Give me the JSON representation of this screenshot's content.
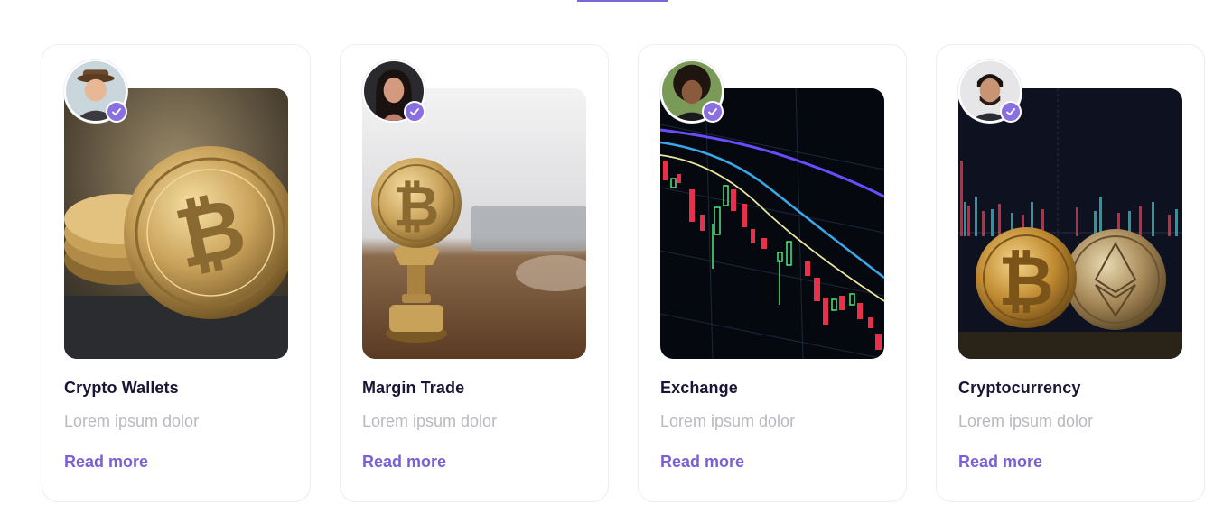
{
  "theme": {
    "accent": "#7a5fd6",
    "title_color": "#1b1535",
    "muted_text": "#b8b8c0",
    "card_border": "#ececf2"
  },
  "cards": [
    {
      "title": "Crypto Wallets",
      "subtitle": "Lorem ipsum dolor",
      "link": "Read more",
      "image": "bitcoin-coins-stack",
      "avatar": "man-with-hat",
      "badge_icon": "check-icon"
    },
    {
      "title": "Margin Trade",
      "subtitle": "Lorem ipsum dolor",
      "link": "Read more",
      "image": "bitcoin-on-stand",
      "avatar": "woman-portrait",
      "badge_icon": "check-icon"
    },
    {
      "title": "Exchange",
      "subtitle": "Lorem ipsum dolor",
      "link": "Read more",
      "image": "candlestick-chart-screen",
      "avatar": "man-curly-hair",
      "badge_icon": "check-icon"
    },
    {
      "title": "Cryptocurrency",
      "subtitle": "Lorem ipsum dolor",
      "link": "Read more",
      "image": "bitcoin-ethereum-coins",
      "avatar": "man-beard",
      "badge_icon": "check-icon"
    }
  ]
}
